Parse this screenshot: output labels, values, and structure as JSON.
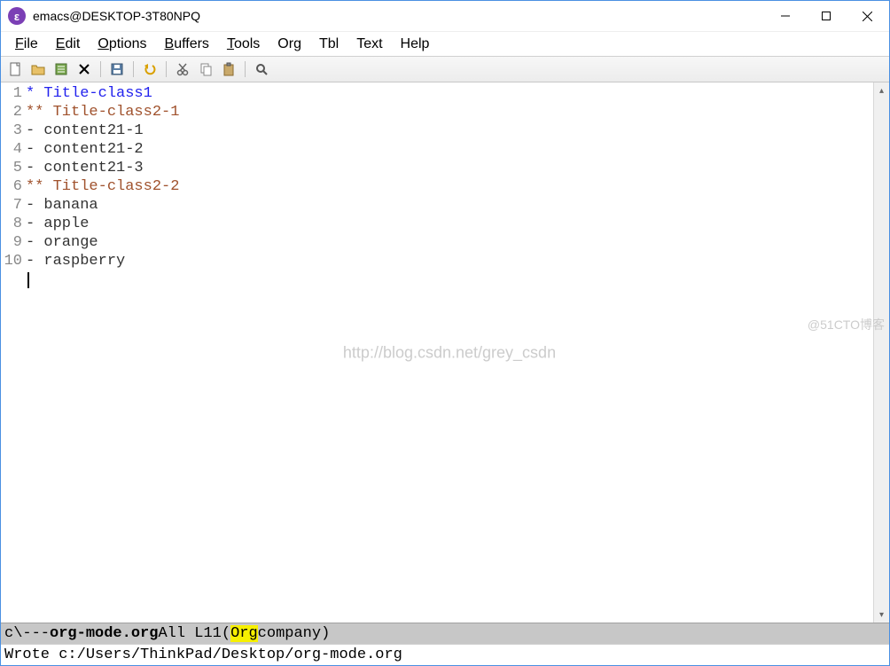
{
  "titlebar": {
    "title": "emacs@DESKTOP-3T80NPQ"
  },
  "menu": {
    "file": "File",
    "edit": "Edit",
    "options": "Options",
    "buffers": "Buffers",
    "tools": "Tools",
    "org": "Org",
    "tbl": "Tbl",
    "text": "Text",
    "help": "Help"
  },
  "toolbar_icons": {
    "new": "new-file-icon",
    "open": "open-folder-icon",
    "dired": "dired-icon",
    "kill": "close-icon",
    "save": "save-icon",
    "undo": "undo-icon",
    "cut": "cut-icon",
    "copy": "copy-icon",
    "paste": "paste-icon",
    "search": "search-icon"
  },
  "editor": {
    "lines": [
      {
        "num": "1",
        "cls": "h1",
        "text": "* Title-class1"
      },
      {
        "num": "2",
        "cls": "h2",
        "text": "** Title-class2-1"
      },
      {
        "num": "3",
        "cls": "body",
        "text": "- content21-1"
      },
      {
        "num": "4",
        "cls": "body",
        "text": "- content21-2"
      },
      {
        "num": "5",
        "cls": "body",
        "text": "- content21-3"
      },
      {
        "num": "6",
        "cls": "h2",
        "text": "** Title-class2-2"
      },
      {
        "num": "7",
        "cls": "body",
        "text": "- banana"
      },
      {
        "num": "8",
        "cls": "body",
        "text": "- apple"
      },
      {
        "num": "9",
        "cls": "body",
        "text": "- orange"
      },
      {
        "num": "10",
        "cls": "body",
        "text": "- raspberry"
      }
    ],
    "watermark": "http://blog.csdn.net/grey_csdn",
    "corner_mark": "@51CTO博客"
  },
  "modeline": {
    "prefix": "c\\---  ",
    "filename": "org-mode.org",
    "pos": "   All L11    ",
    "mode_open": "(",
    "mode_major": "Org",
    "mode_rest": " company)"
  },
  "minibuffer": {
    "text": "Wrote c:/Users/ThinkPad/Desktop/org-mode.org"
  }
}
